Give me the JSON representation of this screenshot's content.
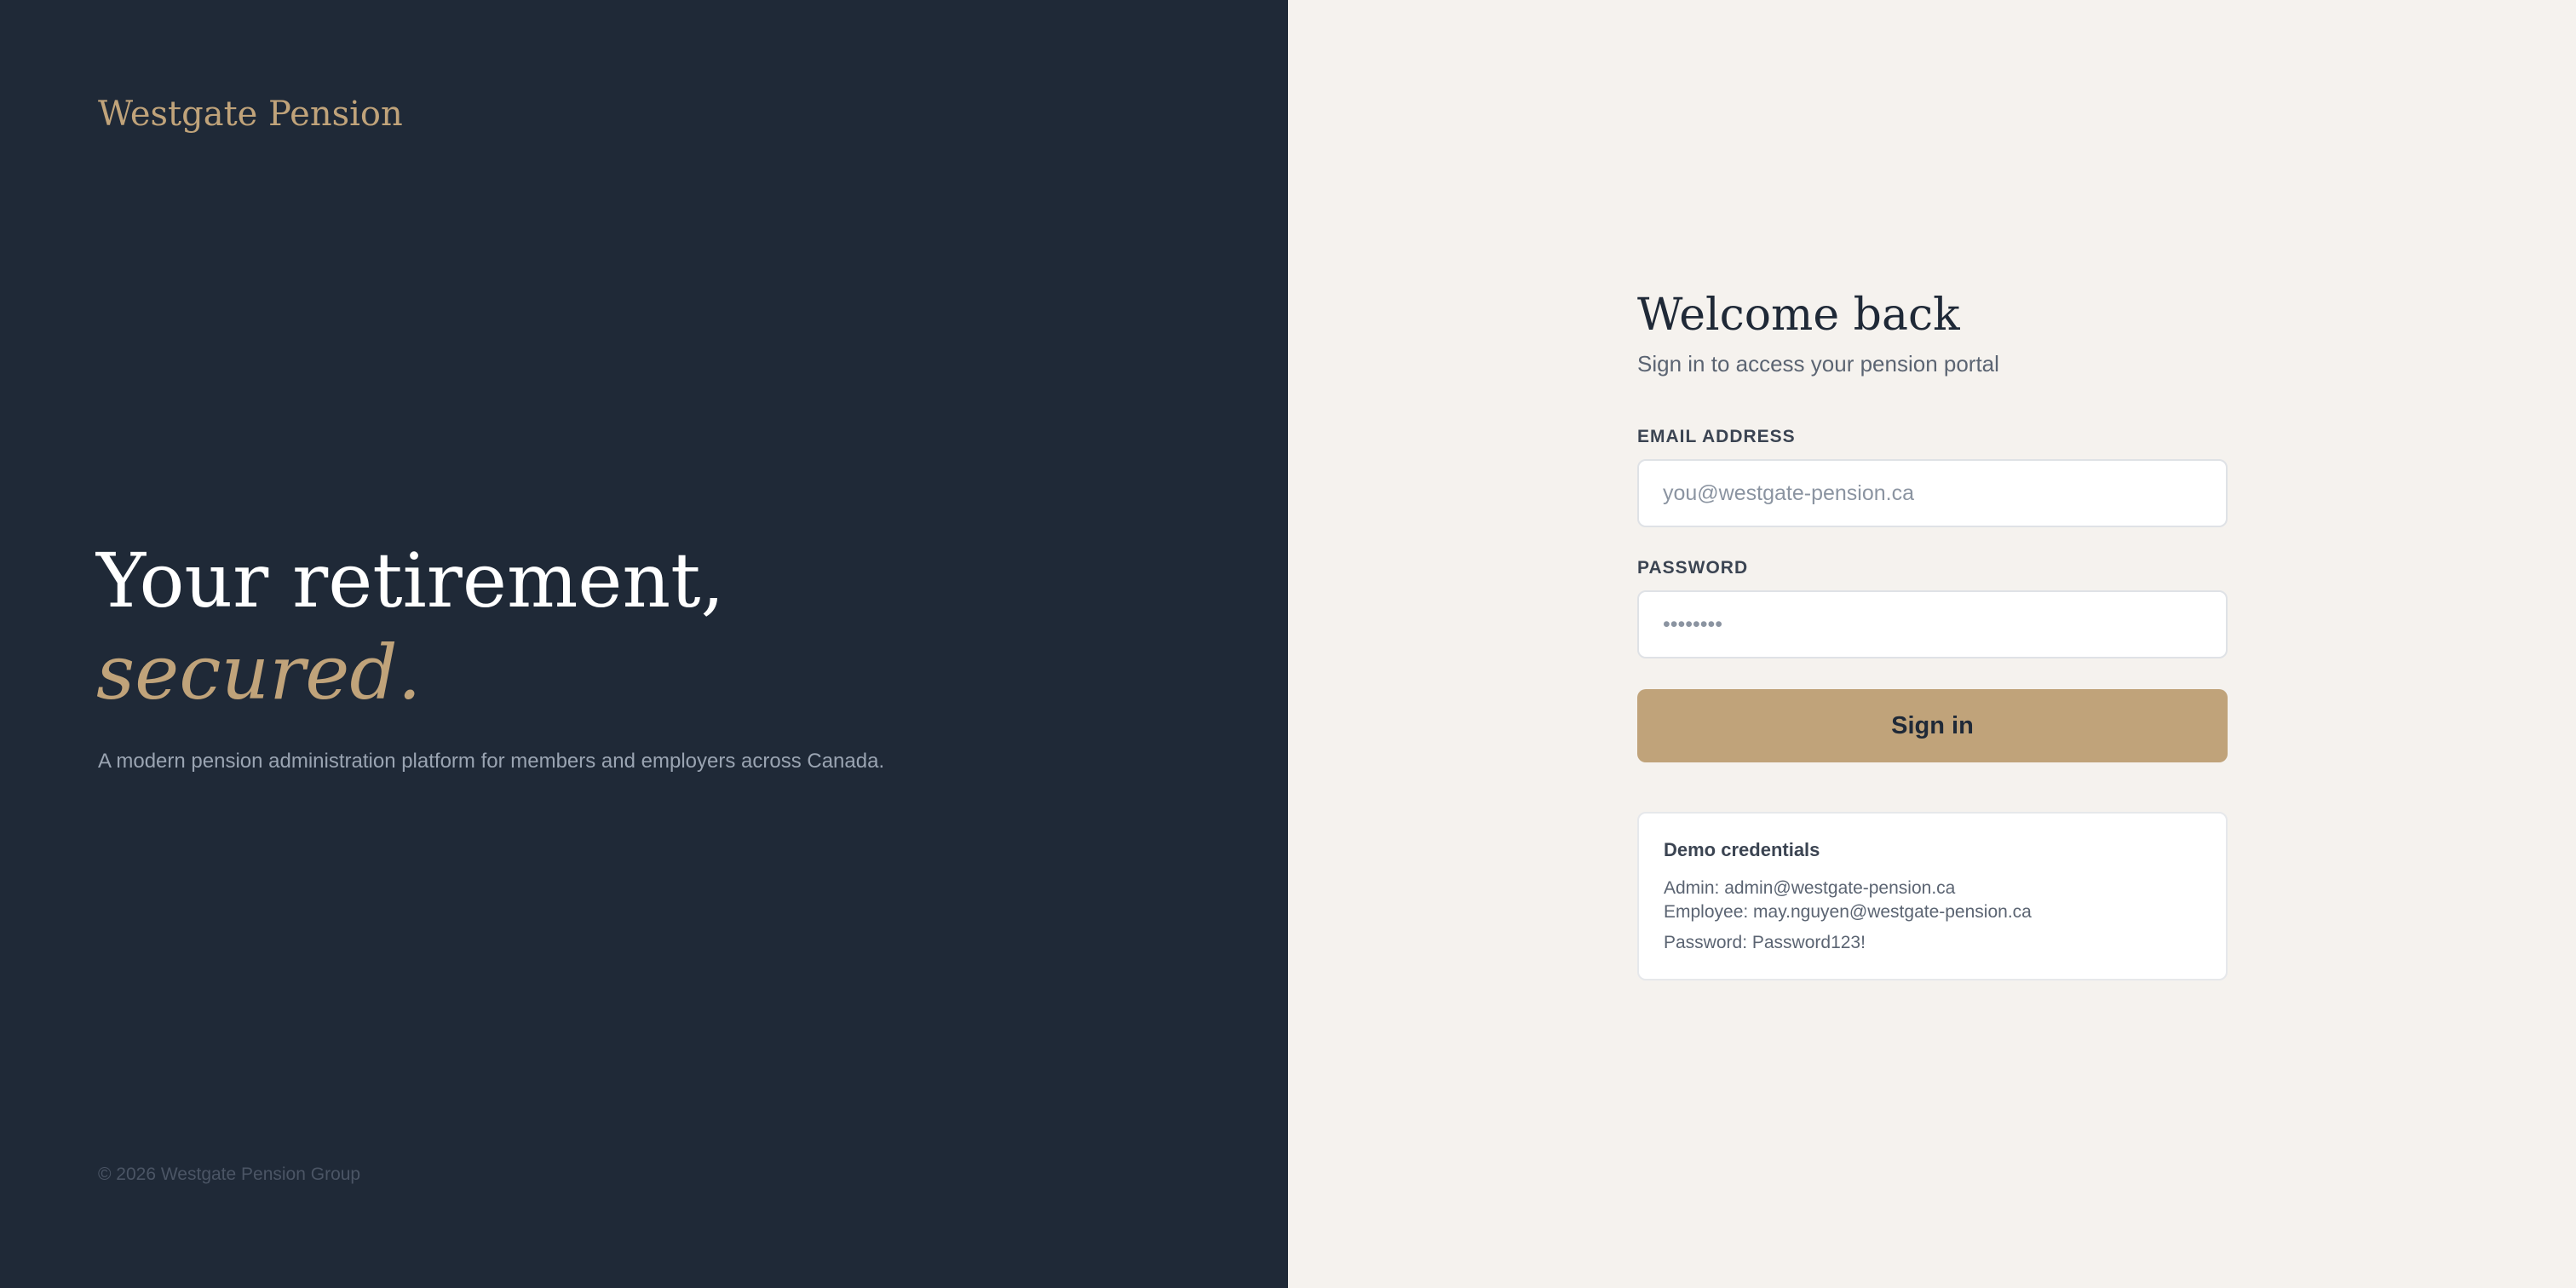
{
  "brand": {
    "name": "Westgate Pension"
  },
  "hero": {
    "line1": "Your retirement,",
    "line2": "secured.",
    "subtitle": "A modern pension administration platform for members and employers across Canada."
  },
  "footer": {
    "copyright": "© 2026 Westgate Pension Group"
  },
  "login": {
    "title": "Welcome back",
    "subtitle": "Sign in to access your pension portal",
    "email_label": "Email address",
    "email_placeholder": "you@westgate-pension.ca",
    "email_value": "",
    "password_label": "Password",
    "password_placeholder": "••••••••",
    "password_value": "",
    "submit_label": "Sign in"
  },
  "demo": {
    "title": "Demo credentials",
    "admin": "Admin: admin@westgate-pension.ca",
    "employee": "Employee: may.nguyen@westgate-pension.ca",
    "password": "Password: Password123!"
  },
  "colors": {
    "panel_dark": "#1f2937",
    "accent_gold": "#c0a37a",
    "panel_light": "#f5f2ee"
  }
}
